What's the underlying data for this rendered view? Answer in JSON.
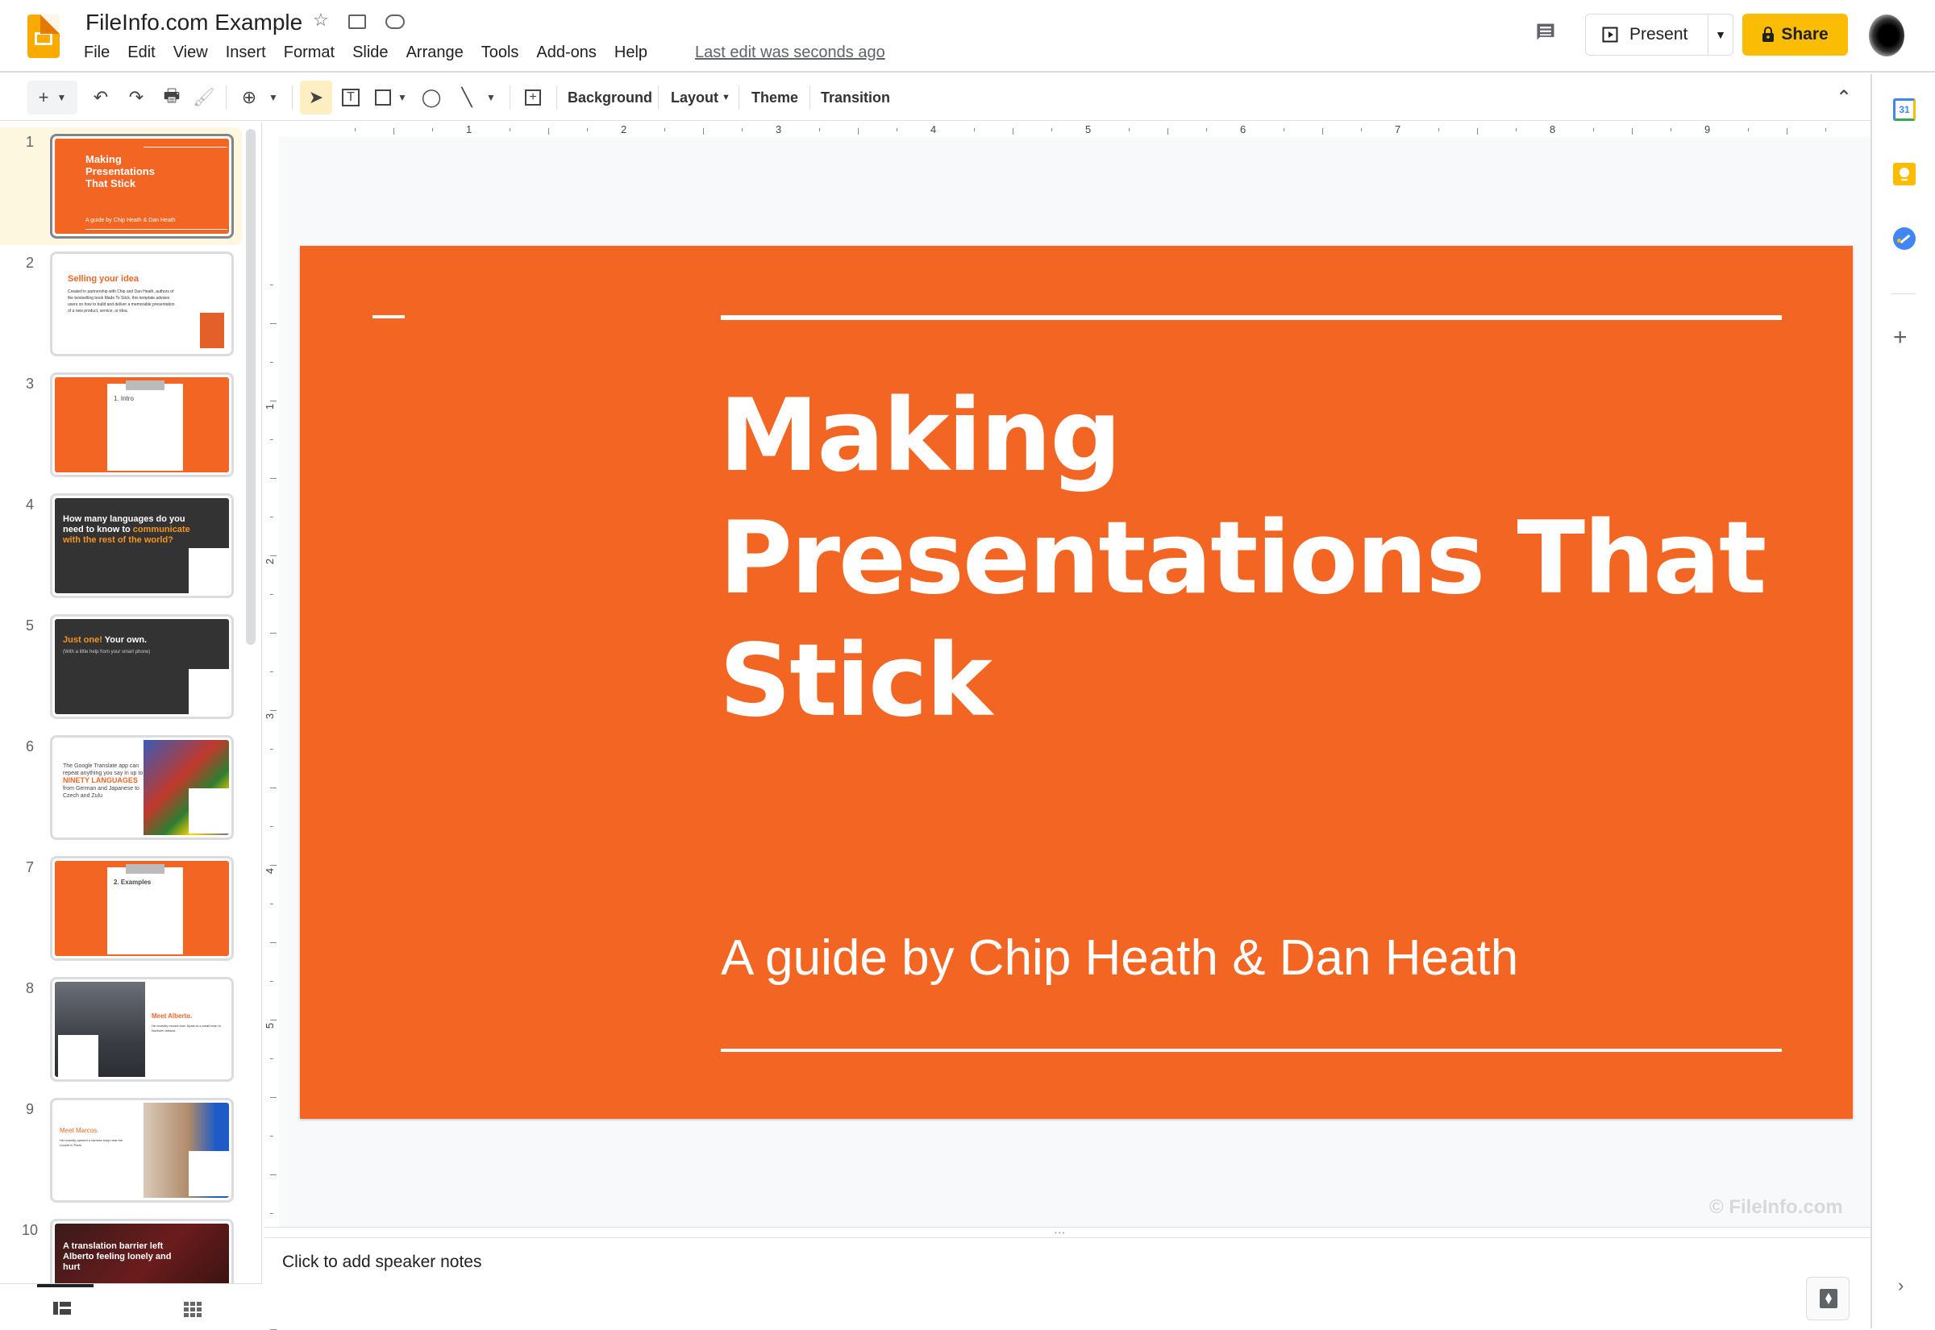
{
  "app": {
    "document_title": "FileInfo.com Example",
    "menu": [
      "File",
      "Edit",
      "View",
      "Insert",
      "Format",
      "Slide",
      "Arrange",
      "Tools",
      "Add-ons",
      "Help"
    ],
    "last_edit": "Last edit was seconds ago",
    "present_label": "Present",
    "share_label": "Share",
    "brand_color": "#fbbc04"
  },
  "toolbar": {
    "background_label": "Background",
    "layout_label": "Layout",
    "theme_label": "Theme",
    "transition_label": "Transition"
  },
  "ruler": {
    "horizontal": [
      "1",
      "2",
      "3",
      "4",
      "5",
      "6",
      "7",
      "8",
      "9"
    ],
    "vertical": [
      "1",
      "2",
      "3",
      "4",
      "5"
    ]
  },
  "filmstrip": {
    "selected": 1,
    "slides": [
      {
        "num": "1",
        "title": "Making Presentations That Stick",
        "subtitle": "A guide by Chip Heath & Dan Heath"
      },
      {
        "num": "2",
        "title": "Selling your idea",
        "body": "Created in partnership with Chip and Dan Heath, authors of the bestselling book Made To Stick, this template advises users on how to build and deliver a memorable presentation of a new product, service, or idea."
      },
      {
        "num": "3",
        "title": "1. Intro"
      },
      {
        "num": "4",
        "title": "How many languages do you need to know to",
        "highlight": "communicate with the rest of the world?"
      },
      {
        "num": "5",
        "highlight": "Just one!",
        "title": " Your own.",
        "body": "(With a little help from your smart phone)"
      },
      {
        "num": "6",
        "body": "The Google Translate app can repeat anything you say in up to",
        "highlight": "NINETY LANGUAGES",
        "body2": "from German and Japanese to Czech and Zulu"
      },
      {
        "num": "7",
        "title": "2. Examples"
      },
      {
        "num": "8",
        "title": "Meet Alberto.",
        "body": "He recently moved from Spain to a small town in Northern Ireland."
      },
      {
        "num": "9",
        "title": "Meet Marcos.",
        "body": "He recently opened a camera shop near the Louvre in Paris."
      },
      {
        "num": "10",
        "title": "A translation barrier left Alberto feeling lonely and hurt"
      }
    ]
  },
  "slide": {
    "title": "Making Presentations That Stick",
    "subtitle": "A guide by Chip Heath & Dan Heath",
    "background_color": "#f26522"
  },
  "watermark": "© FileInfo.com",
  "notes": {
    "placeholder": "Click to add speaker notes"
  }
}
